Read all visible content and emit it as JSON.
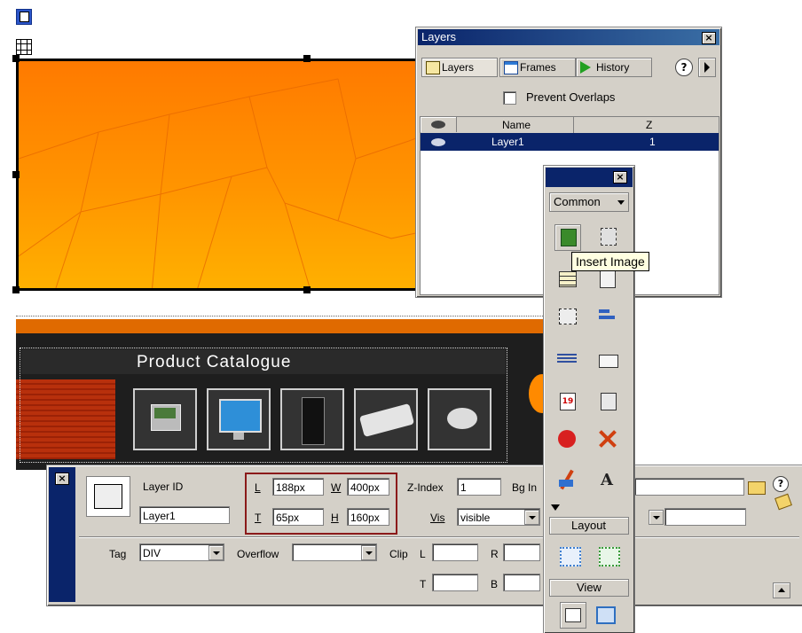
{
  "layers_panel": {
    "title": "Layers",
    "tabs": [
      {
        "label": "Layers"
      },
      {
        "label": "Frames"
      },
      {
        "label": "History"
      }
    ],
    "prevent_overlaps_label": "Prevent Overlaps",
    "prevent_overlaps_checked": false,
    "columns": [
      "Name",
      "Z"
    ],
    "rows": [
      {
        "name": "Layer1",
        "z": "1"
      }
    ]
  },
  "page_banner": {
    "heading": "Product Catalogue",
    "thumbnails": [
      "pos-terminal",
      "flat-monitor",
      "pc-tower",
      "keyboard",
      "mouse"
    ]
  },
  "insert_bar": {
    "category": "Common",
    "tooltip": "Insert Image",
    "layout_label": "Layout",
    "view_label": "View"
  },
  "property_inspector": {
    "layer_id_label": "Layer ID",
    "layer_id_value": "Layer1",
    "L_label": "L",
    "L_value": "188px",
    "T_label": "T",
    "T_value": "65px",
    "W_label": "W",
    "W_value": "400px",
    "H_label": "H",
    "H_value": "160px",
    "zindex_label": "Z-Index",
    "zindex_value": "1",
    "bgimage_label": "Bg In",
    "vis_label": "Vis",
    "vis_value": "visible",
    "tag_label": "Tag",
    "tag_value": "DIV",
    "overflow_label": "Overflow",
    "overflow_value": "",
    "clip_label": "Clip",
    "clip_L": "L",
    "clip_R": "R",
    "clip_T": "T",
    "clip_B": "B"
  },
  "colors": {
    "title_bar": "#0a246a",
    "selection": "#0a246a",
    "panel_bg": "#d4d0c8",
    "highlight_box": "#8b1a1a",
    "banner_orange": "#ff8a00"
  }
}
